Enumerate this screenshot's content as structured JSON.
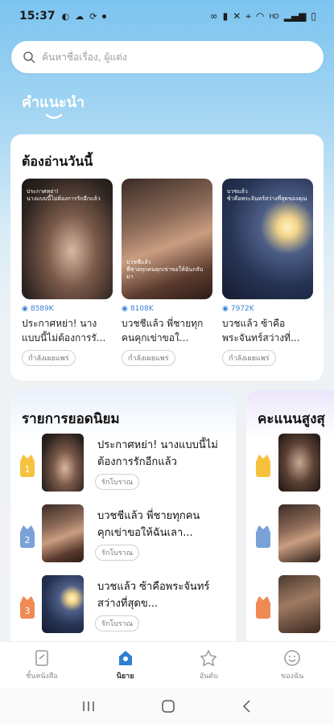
{
  "status": {
    "time": "15:37",
    "right_text": "HD"
  },
  "search": {
    "placeholder": "ค้นหาชื่อเรื่อง, ผู้แต่ง"
  },
  "tab": {
    "title": "คำแนะนำ"
  },
  "today": {
    "title": "ต้องอ่านวันนี้",
    "books": [
      {
        "views": "8589K",
        "title": "ประกาศหย่า! นางแบบนี้ไม่ต้องการรั...",
        "tag": "กำลังเผยแพร่",
        "cover_text": "ประกาศหย่า!\nนางแบบนี้ไม่ต้องการรักอีกแล้ว"
      },
      {
        "views": "8108K",
        "title": "บวชชีแล้ว พี่ชายทุกคนคุกเข่าขอใ...",
        "tag": "กำลังเผยแพร่",
        "cover_text": "บวชชีแล้ว\nพี่ชายทุกคนคุกเข่าขอให้ฉันกลับมา"
      },
      {
        "views": "7972K",
        "title": "บวชแล้ว ซ้าคือพระจันทร์สว่างที่...",
        "tag": "กำลังเผยแพร่",
        "cover_text": "บวชแล้ว\nซ้าคือพระจันทร์สว่างที่สุดของคุณ"
      }
    ]
  },
  "ranking": {
    "title": "รายการยอดนิยม",
    "items": [
      {
        "rank": "1",
        "title": "ประกาศหย่า! นางแบบนี้ไม่ต้องการรักอีกแล้ว",
        "tag": "รักโบราณ"
      },
      {
        "rank": "2",
        "title": "บวชชีแล้ว พี่ชายทุกคนคุกเข่าขอให้ฉันเลา...",
        "tag": "รักโบราณ"
      },
      {
        "rank": "3",
        "title": "บวชแล้ว ซ้าคือพระจันทร์สว่างที่สุดข...",
        "tag": "รักโบราณ"
      }
    ]
  },
  "ranking2": {
    "title": "คะแนนสูงสุ"
  },
  "nav": {
    "items": [
      {
        "label": "ชั้นหนังสือ"
      },
      {
        "label": "นิยาย"
      },
      {
        "label": "อันดับ"
      },
      {
        "label": "ของฉัน"
      }
    ]
  },
  "colors": {
    "accent": "#3b82d6",
    "active_nav": "#2f7fd4",
    "badge1": "#f6c23e",
    "badge2": "#7aa1d8",
    "badge3": "#ef8a55"
  }
}
